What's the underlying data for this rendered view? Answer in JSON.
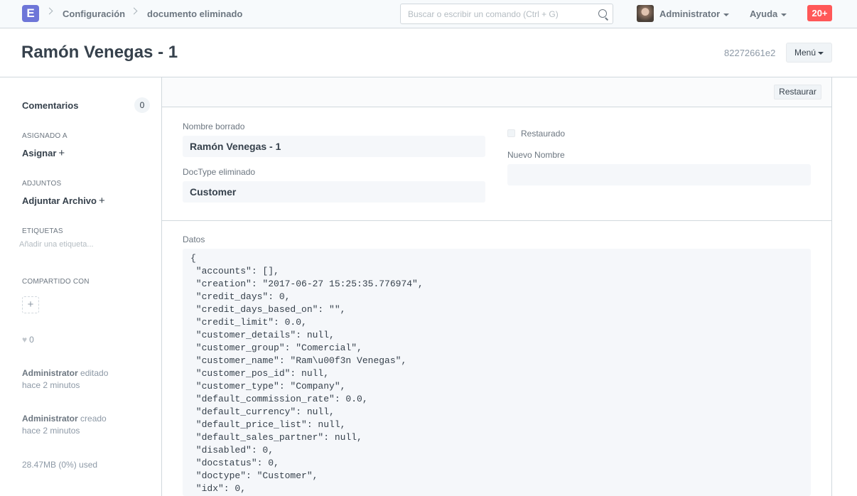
{
  "navbar": {
    "logo_letter": "E",
    "breadcrumbs": [
      "Configuración",
      "documento eliminado"
    ],
    "search_placeholder": "Buscar o escribir un comando (Ctrl + G)",
    "user": "Administrator",
    "help": "Ayuda",
    "notifications": "20+"
  },
  "page": {
    "title": "Ramón Venegas - 1",
    "doc_id": "82272661e2",
    "menu_label": "Menú"
  },
  "sidebar": {
    "comments_label": "Comentarios",
    "comments_count": "0",
    "assigned_label": "ASIGNADO A",
    "assign_action": "Asignar",
    "attachments_label": "ADJUNTOS",
    "attach_action": "Adjuntar Archivo",
    "tags_label": "ETIQUETAS",
    "tags_placeholder": "Añadir una etiqueta...",
    "shared_label": "COMPARTIDO CON",
    "likes": "0",
    "activity": [
      {
        "user": "Administrator",
        "action": "editado",
        "time": "hace 2 minutos"
      },
      {
        "user": "Administrator",
        "action": "creado",
        "time": "hace 2 minutos"
      }
    ],
    "usage": "28.47MB (0%) used"
  },
  "form": {
    "restore_button": "Restaurar",
    "deleted_name_label": "Nombre borrado",
    "deleted_name_value": "Ramón Venegas - 1",
    "deleted_doctype_label": "DocType eliminado",
    "deleted_doctype_value": "Customer",
    "restored_label": "Restaurado",
    "new_name_label": "Nuevo Nombre",
    "new_name_value": "",
    "data_label": "Datos",
    "data_lines": [
      "{",
      " \"accounts\": [],",
      " \"creation\": \"2017-06-27 15:25:35.776974\",",
      " \"credit_days\": 0,",
      " \"credit_days_based_on\": \"\",",
      " \"credit_limit\": 0.0,",
      " \"customer_details\": null,",
      " \"customer_group\": \"Comercial\",",
      " \"customer_name\": \"Ram\\u00f3n Venegas\",",
      " \"customer_pos_id\": null,",
      " \"customer_type\": \"Company\",",
      " \"default_commission_rate\": 0.0,",
      " \"default_currency\": null,",
      " \"default_price_list\": null,",
      " \"default_sales_partner\": null,",
      " \"disabled\": 0,",
      " \"docstatus\": 0,",
      " \"doctype\": \"Customer\",",
      " \"idx\": 0,"
    ]
  }
}
